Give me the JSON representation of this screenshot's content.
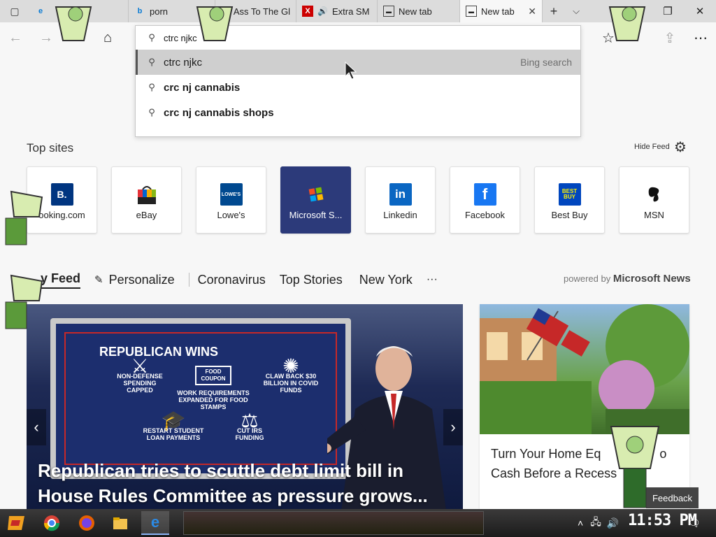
{
  "tabs": [
    {
      "label": "",
      "favicon": "edge-icon"
    },
    {
      "label": "porn",
      "favicon": "bing-icon"
    },
    {
      "label": "Ass To The Gl",
      "favicon": "search-icon"
    },
    {
      "label": "Extra SM",
      "favicon": "x-icon",
      "audio": true
    },
    {
      "label": "New tab",
      "favicon": "newtab-icon"
    },
    {
      "label": "New tab",
      "favicon": "newtab-icon",
      "active": true
    }
  ],
  "address": {
    "value": "ctrc njkc",
    "suggestions": [
      {
        "text": "ctrc njkc",
        "hint": "Bing search",
        "selected": true
      },
      {
        "text": "crc nj cannabis",
        "hint": ""
      },
      {
        "text": "crc nj cannabis shops",
        "hint": ""
      }
    ]
  },
  "top_sites": {
    "title": "Top sites",
    "hide_feed": "Hide Feed",
    "items": [
      {
        "label": "Booking.com",
        "display": "ooking.com",
        "color": "#003580",
        "mark": "B."
      },
      {
        "label": "eBay",
        "display": "eBay",
        "color": "#e53238",
        "mark": "bag"
      },
      {
        "label": "Lowe's",
        "display": "Lowe's",
        "color": "#004990",
        "mark": "LOWE'S"
      },
      {
        "label": "Microsoft S...",
        "display": "Microsoft S...",
        "color": "#2c3a7a",
        "mark": "ms",
        "selected": true
      },
      {
        "label": "Linkedin",
        "display": "Linkedin",
        "color": "#0a66c2",
        "mark": "in"
      },
      {
        "label": "Facebook",
        "display": "Facebook",
        "color": "#1877f2",
        "mark": "f"
      },
      {
        "label": "Best Buy",
        "display": "Best Buy",
        "color": "#0046be",
        "mark": "BEST BUY"
      },
      {
        "label": "MSN",
        "display": "MSN",
        "color": "#111111",
        "mark": "msn"
      }
    ]
  },
  "feed": {
    "tabs": [
      "y Feed",
      "Personalize",
      "Coronavirus",
      "Top Stories",
      "New York",
      "···"
    ],
    "powered_prefix": "powered by",
    "powered_brand": "Microsoft News",
    "hero": {
      "headline": "Republican tries to scuttle debt limit bill in House Rules Committee as pressure grows...",
      "screen_title": "REPUBLICAN WINS",
      "screen_items": [
        "NON-DEFENSE SPENDING CAPPED",
        "WORK REQUIREMENTS EXPANDED FOR FOOD STAMPS",
        "CLAW BACK $30 BILLION IN COVID FUNDS",
        "RESTART STUDENT LOAN PAYMENTS",
        "CUT IRS FUNDING"
      ],
      "screen_icon_labels": [
        "FOOD COUPON"
      ]
    },
    "side": {
      "headline": "Turn Your Home Eq",
      "headline_tail": "o",
      "line2": "Cash Before a Recess"
    },
    "feedback": "Feedback"
  },
  "taskbar": {
    "clock": "11:53 PM"
  }
}
